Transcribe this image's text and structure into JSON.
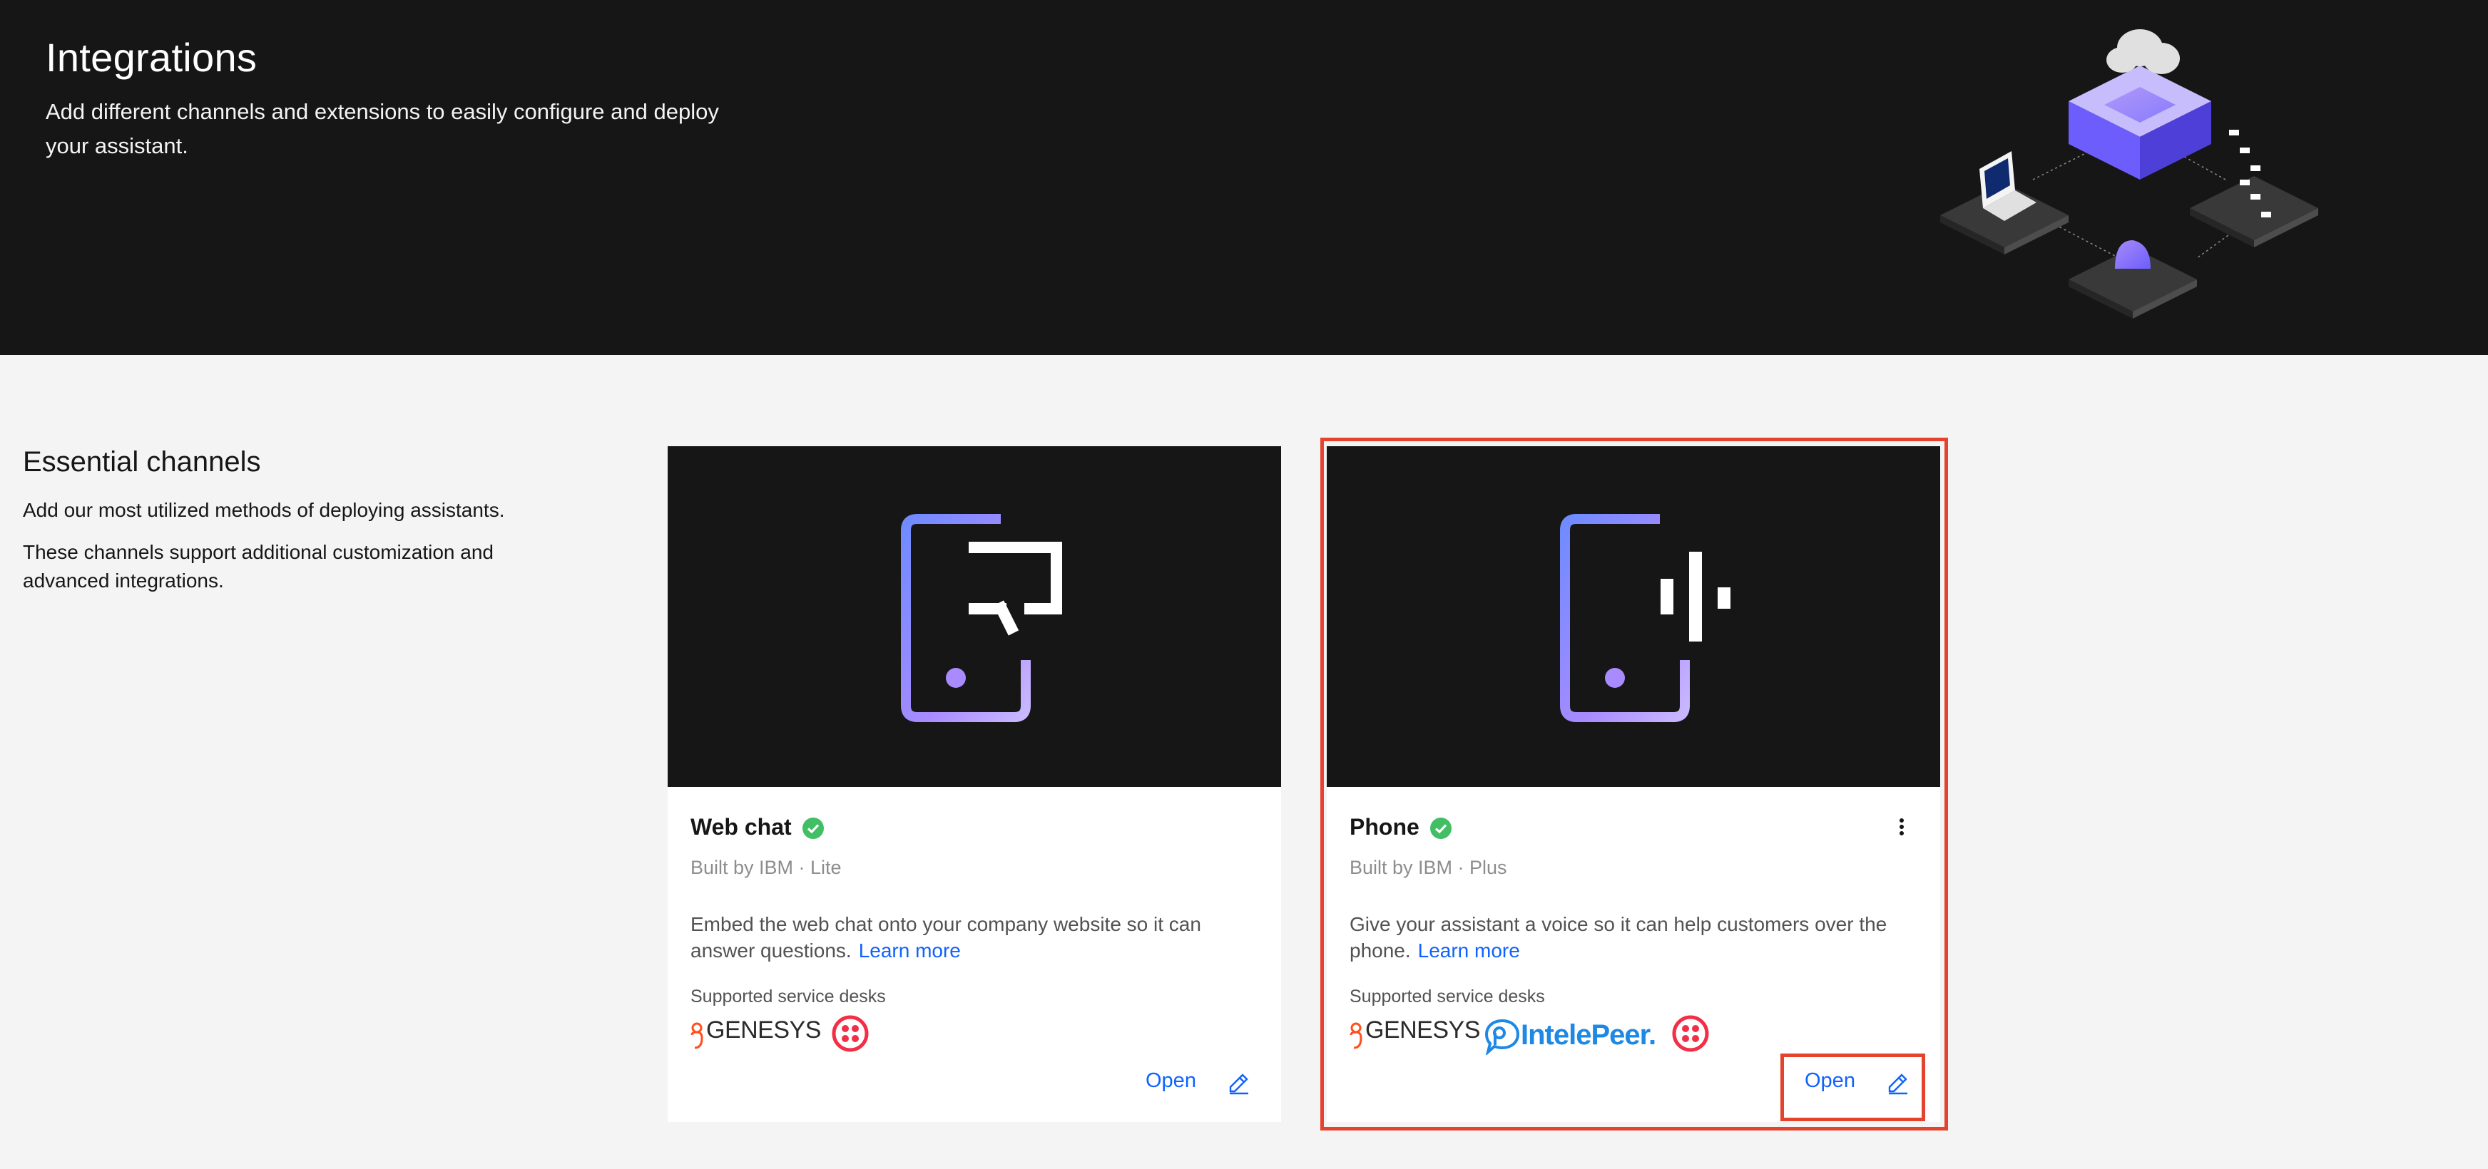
{
  "header": {
    "title": "Integrations",
    "subtitle": "Add different channels and extensions to easily configure and deploy your assistant."
  },
  "section": {
    "title": "Essential channels",
    "description_1": "Add our most utilized methods of deploying assistants.",
    "description_2": "These channels support additional customization and advanced integrations."
  },
  "cards": [
    {
      "title": "Web chat",
      "status_icon": "check-circle-icon",
      "meta": "Built by IBM · Lite",
      "description": "Embed the web chat onto your company website so it can answer questions.",
      "learn_more": "Learn more",
      "service_desks_label": "Supported service desks",
      "service_desks": [
        "GENESYS",
        "twilio"
      ],
      "open_label": "Open",
      "edit_icon": "edit-icon"
    },
    {
      "title": "Phone",
      "status_icon": "check-circle-icon",
      "meta": "Built by IBM · Plus",
      "description": "Give your assistant a voice so it can help customers over the phone.",
      "learn_more": "Learn more",
      "service_desks_label": "Supported service desks",
      "service_desks": [
        "GENESYS",
        "IntelePeer.",
        "twilio"
      ],
      "open_label": "Open",
      "edit_icon": "edit-icon",
      "overflow_icon": "overflow-menu-icon"
    }
  ],
  "colors": {
    "banner_bg": "#161616",
    "page_bg": "#f4f4f4",
    "link": "#0f62fe",
    "success": "#42be65",
    "highlight": "#e4442e",
    "genesys": "#ff4f1f",
    "twilio": "#f22f46",
    "intelepeer": "#1e88e5"
  }
}
